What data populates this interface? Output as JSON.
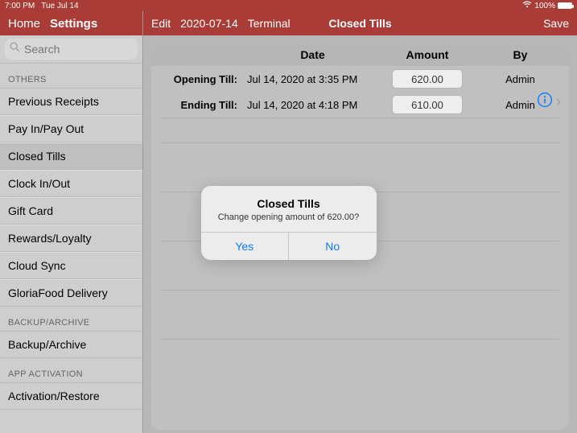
{
  "statusbar": {
    "time": "7:00 PM",
    "date": "Tue Jul 14",
    "battery": "100%"
  },
  "sidebar": {
    "home": "Home",
    "settings": "Settings",
    "search_placeholder": "Search",
    "sections": [
      {
        "header": "OTHERS",
        "items": [
          {
            "label": "Previous Receipts",
            "active": false
          },
          {
            "label": "Pay In/Pay Out",
            "active": false
          },
          {
            "label": "Closed Tills",
            "active": true
          },
          {
            "label": "Clock In/Out",
            "active": false
          },
          {
            "label": "Gift Card",
            "active": false
          },
          {
            "label": "Rewards/Loyalty",
            "active": false
          },
          {
            "label": "Cloud Sync",
            "active": false
          },
          {
            "label": "GloriaFood Delivery",
            "active": false
          }
        ]
      },
      {
        "header": "BACKUP/ARCHIVE",
        "items": [
          {
            "label": "Backup/Archive",
            "active": false
          }
        ]
      },
      {
        "header": "APP ACTIVATION",
        "items": [
          {
            "label": "Activation/Restore",
            "active": false
          }
        ]
      }
    ]
  },
  "mainnav": {
    "edit": "Edit",
    "date": "2020-07-14",
    "terminal": "Terminal",
    "title": "Closed Tills",
    "save": "Save"
  },
  "table": {
    "headers": {
      "date": "Date",
      "amount": "Amount",
      "by": "By"
    },
    "rows": [
      {
        "label": "Opening Till:",
        "date": "Jul 14, 2020 at 3:35 PM",
        "amount": "620.00",
        "by": "Admin"
      },
      {
        "label": "Ending Till:",
        "date": "Jul 14, 2020 at 4:18 PM",
        "amount": "610.00",
        "by": "Admin"
      }
    ]
  },
  "alert": {
    "title": "Closed Tills",
    "message": "Change opening amount of 620.00?",
    "yes": "Yes",
    "no": "No"
  }
}
